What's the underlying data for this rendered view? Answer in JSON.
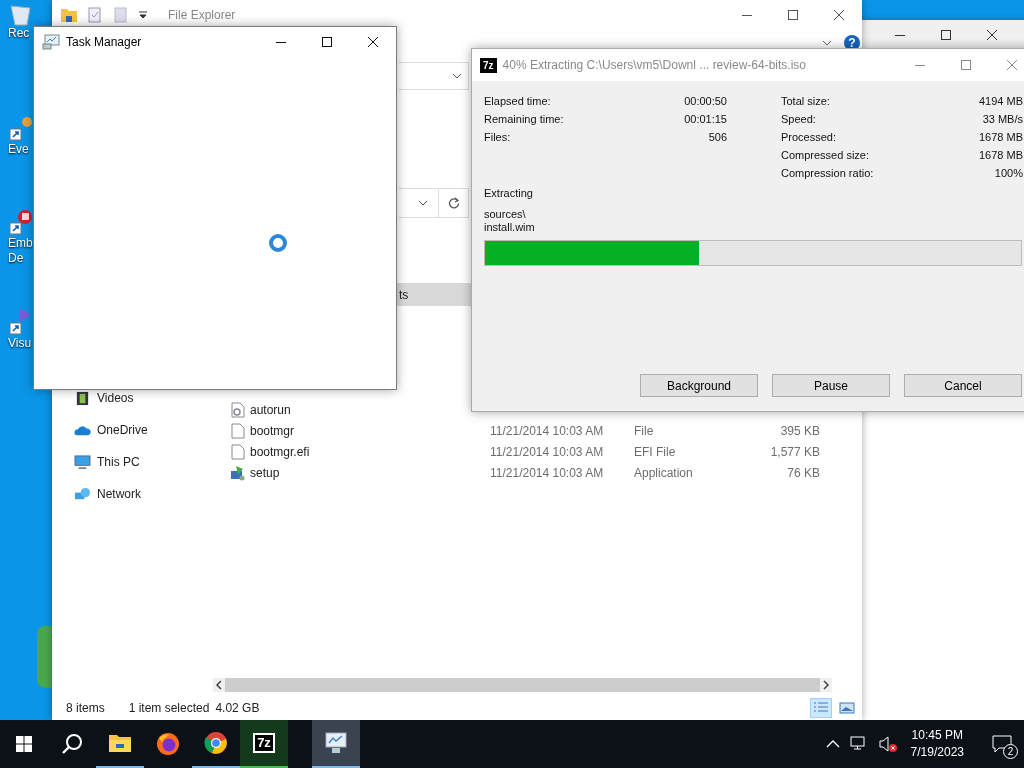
{
  "desktop": {
    "icons": [
      {
        "kind": "recycle-bin",
        "lines": [
          "Rec"
        ]
      },
      {
        "kind": "shortcut",
        "lines": [
          "Eve"
        ]
      },
      {
        "kind": "red-shortcut",
        "lines": [
          "Emb",
          "De"
        ]
      },
      {
        "kind": "purple-shortcut",
        "lines": [
          "Visu"
        ]
      },
      {
        "kind": "app-tile"
      }
    ]
  },
  "file_explorer": {
    "title": "File Explorer",
    "help_glyph": "?",
    "column_fragment": "ts",
    "nav": [
      {
        "label": "Videos",
        "kind": "videos"
      },
      {
        "label": "OneDrive",
        "kind": "cloud"
      },
      {
        "label": "This PC",
        "kind": "pc"
      },
      {
        "label": "Network",
        "kind": "network"
      }
    ],
    "files": [
      {
        "name": "autorun",
        "kind": "settings-file"
      },
      {
        "name": "bootmgr",
        "kind": "file",
        "modified": "11/21/2014 10:03 AM",
        "type": "File",
        "size": "395 KB"
      },
      {
        "name": "bootmgr.efi",
        "kind": "file",
        "modified": "11/21/2014 10:03 AM",
        "type": "EFI File",
        "size": "1,577 KB"
      },
      {
        "name": "setup",
        "kind": "setup",
        "modified": "11/21/2014 10:03 AM",
        "type": "Application",
        "size": "76 KB"
      }
    ],
    "status": {
      "items": "8 items",
      "selected": "1 item selected",
      "size": "4.02 GB"
    },
    "views": [
      {
        "kind": "details",
        "selected": true
      },
      {
        "kind": "tiles",
        "selected": false
      }
    ]
  },
  "task_manager": {
    "title": "Task Manager"
  },
  "extract_dialog": {
    "logo": "7z",
    "title": "40% Extracting C:\\Users\\vm5\\Downl ... review-64-bits.iso",
    "left_stats": [
      {
        "label": "Elapsed time:",
        "value": "00:00:50"
      },
      {
        "label": "Remaining time:",
        "value": "00:01:15"
      },
      {
        "label": "Files:",
        "value": "506"
      }
    ],
    "right_stats": [
      {
        "label": "Total size:",
        "value": "4194 MB"
      },
      {
        "label": "Speed:",
        "value": "33 MB/s"
      },
      {
        "label": "Processed:",
        "value": "1678 MB"
      },
      {
        "label": "Compressed size:",
        "value": "1678 MB"
      },
      {
        "label": "Compression ratio:",
        "value": "100%"
      }
    ],
    "status": "Extracting",
    "current_folder": "sources\\",
    "current_file": "install.wim",
    "progress": {
      "level": 0.4
    },
    "buttons": [
      "Background",
      "Pause",
      "Cancel"
    ]
  },
  "taskbar": {
    "apps": [
      {
        "kind": "file-explorer",
        "running": true,
        "selected": false
      },
      {
        "kind": "firefox",
        "running": false,
        "selected": false
      },
      {
        "kind": "chrome",
        "running": true,
        "selected": false
      },
      {
        "kind": "archiver",
        "label": "7z",
        "running": true,
        "selected": false
      },
      {
        "kind": "task-manager",
        "running": true,
        "selected": true
      }
    ],
    "muted": true,
    "time": "10:45 PM",
    "date": "7/19/2023",
    "notifications": "2"
  }
}
